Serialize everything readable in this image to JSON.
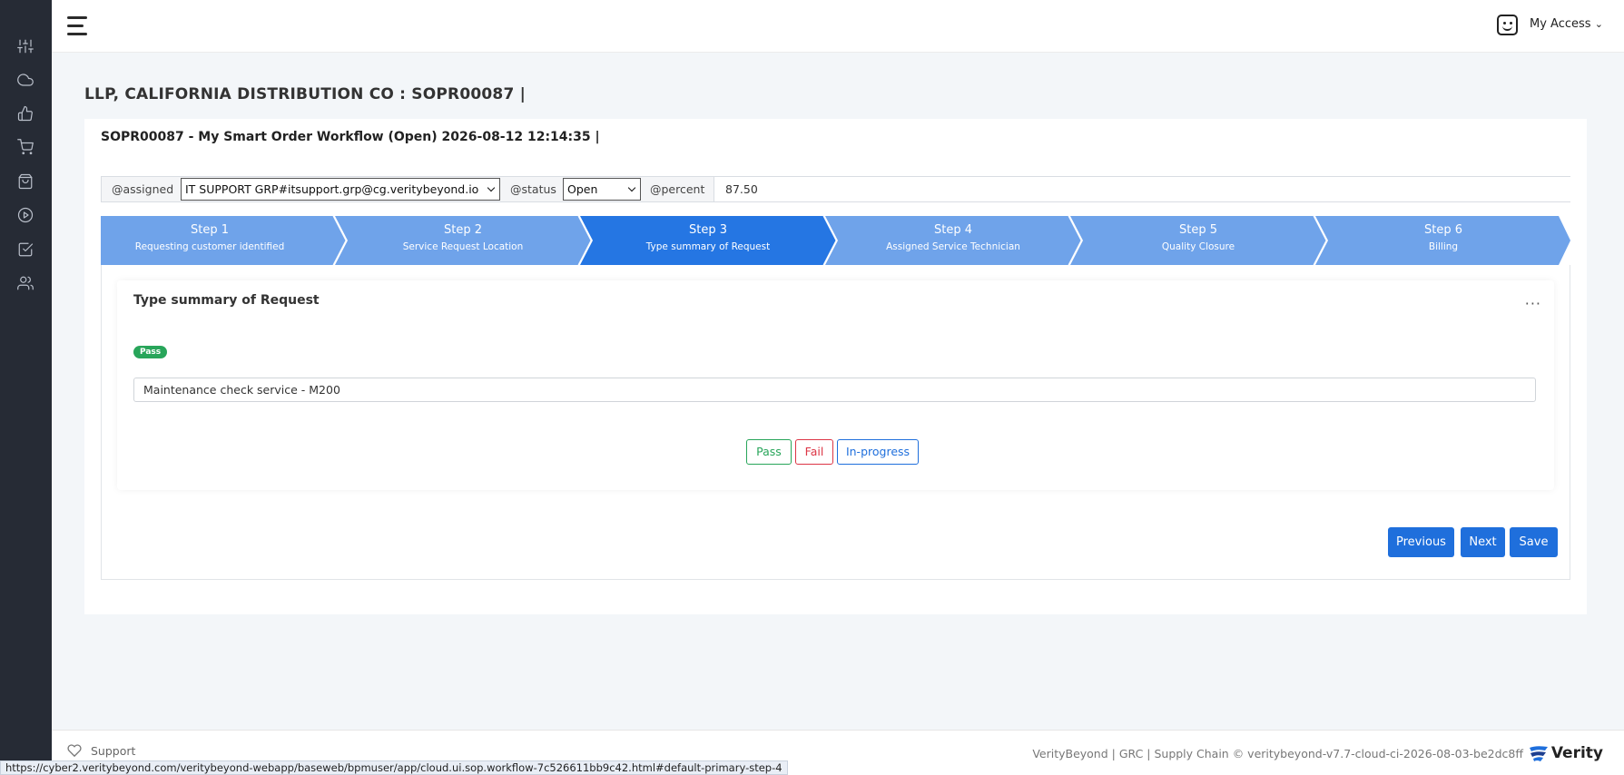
{
  "sidebar": {
    "items": [
      {
        "icon": "sliders-icon"
      },
      {
        "icon": "cloud-icon"
      },
      {
        "icon": "thumbs-up-icon"
      },
      {
        "icon": "cart-icon"
      },
      {
        "icon": "shopping-bag-icon"
      },
      {
        "icon": "play-circle-icon"
      },
      {
        "icon": "check-square-icon"
      },
      {
        "icon": "users-icon"
      }
    ]
  },
  "topbar": {
    "menu_icon": "hamburger-icon",
    "access_label": "My Access",
    "access_chevron": "⌄"
  },
  "page": {
    "title": "LLP, CALIFORNIA DISTRIBUTION CO : SOPR00087 |"
  },
  "workflow": {
    "title": "SOPR00087 - My Smart Order Workflow (Open) 2026-08-12 12:14:35 |",
    "assigned_label": "@assigned",
    "assigned_value": "IT SUPPORT GRP#itsupport.grp@cg.veritybeyond.io",
    "status_label": "@status",
    "status_value": "Open",
    "percent_label": "@percent",
    "percent_value": "87.50"
  },
  "steps": [
    {
      "title": "Step 1",
      "subtitle": "Requesting customer identified",
      "active": false
    },
    {
      "title": "Step 2",
      "subtitle": "Service Request Location",
      "active": false
    },
    {
      "title": "Step 3",
      "subtitle": "Type summary of Request",
      "active": true
    },
    {
      "title": "Step 4",
      "subtitle": "Assigned Service Technician",
      "active": false
    },
    {
      "title": "Step 5",
      "subtitle": "Quality Closure",
      "active": false
    },
    {
      "title": "Step 6",
      "subtitle": "Billing",
      "active": false
    }
  ],
  "panel": {
    "title": "Type summary of Request",
    "menu": "···",
    "badge": "Pass",
    "summary_value": "Maintenance check service - M200",
    "options": {
      "pass": "Pass",
      "fail": "Fail",
      "in_progress": "In-progress"
    }
  },
  "actions": {
    "previous": "Previous",
    "next": "Next",
    "save": "Save"
  },
  "footer": {
    "support_label": "Support",
    "text": "VerityBeyond | GRC | Supply Chain © veritybeyond-v7.7-cloud-ci-2026-08-03-be2dc8ff",
    "logo_text": "Verity"
  },
  "status_url": "https://cyber2.veritybeyond.com/veritybeyond-webapp/baseweb/bpmuser/app/cloud.ui.sop.workflow-7c526611bb9c42.html#default-primary-step-4",
  "colors": {
    "sidebar": "#262b35",
    "step_inactive": "#6fa3ea",
    "step_active": "#2576e3",
    "primary_button": "#1f6fdc",
    "pass": "#28a55a",
    "fail": "#dc3545",
    "in_progress": "#1f6fdc"
  }
}
